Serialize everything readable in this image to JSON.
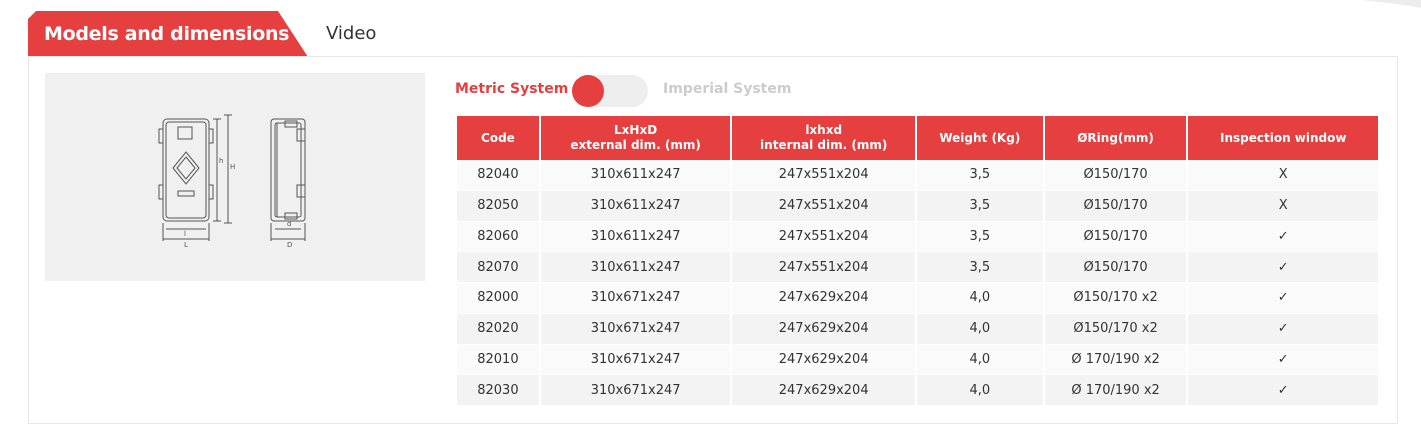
{
  "tabs": {
    "active_label": "Models and dimensions",
    "video_label": "Video"
  },
  "figure": {
    "icon": "fire-extinguisher-cabinet-drawing",
    "dim_labels": [
      "H",
      "h",
      "l",
      "L",
      "d",
      "D"
    ]
  },
  "units_toggle": {
    "metric_label": "Metric System",
    "imperial_label": "Imperial System",
    "selected": "Metric System"
  },
  "colors": {
    "accent": "#e63f3f",
    "row_light": "#fafafa",
    "row_dark": "#f3f3f3",
    "inactive_text": "#cccccc"
  },
  "table": {
    "headers": [
      {
        "line1": "Code",
        "line2": ""
      },
      {
        "line1": "LxHxD",
        "line2": "external dim. (mm)"
      },
      {
        "line1": "lxhxd",
        "line2": "internal dim. (mm)"
      },
      {
        "line1": "Weight (Kg)",
        "line2": ""
      },
      {
        "line1": "ØRing(mm)",
        "line2": ""
      },
      {
        "line1": "Inspection window",
        "line2": ""
      }
    ],
    "rows": [
      [
        "82040",
        "310x611x247",
        "247x551x204",
        "3,5",
        "Ø150/170",
        "X"
      ],
      [
        "82050",
        "310x611x247",
        "247x551x204",
        "3,5",
        "Ø150/170",
        "X"
      ],
      [
        "82060",
        "310x611x247",
        "247x551x204",
        "3,5",
        "Ø150/170",
        "✓"
      ],
      [
        "82070",
        "310x611x247",
        "247x551x204",
        "3,5",
        "Ø150/170",
        "✓"
      ],
      [
        "82000",
        "310x671x247",
        "247x629x204",
        "4,0",
        "Ø150/170 x2",
        "✓"
      ],
      [
        "82020",
        "310x671x247",
        "247x629x204",
        "4,0",
        "Ø150/170 x2",
        "✓"
      ],
      [
        "82010",
        "310x671x247",
        "247x629x204",
        "4,0",
        "Ø 170/190 x2",
        "✓"
      ],
      [
        "82030",
        "310x671x247",
        "247x629x204",
        "4,0",
        "Ø 170/190 x2",
        "✓"
      ]
    ]
  }
}
